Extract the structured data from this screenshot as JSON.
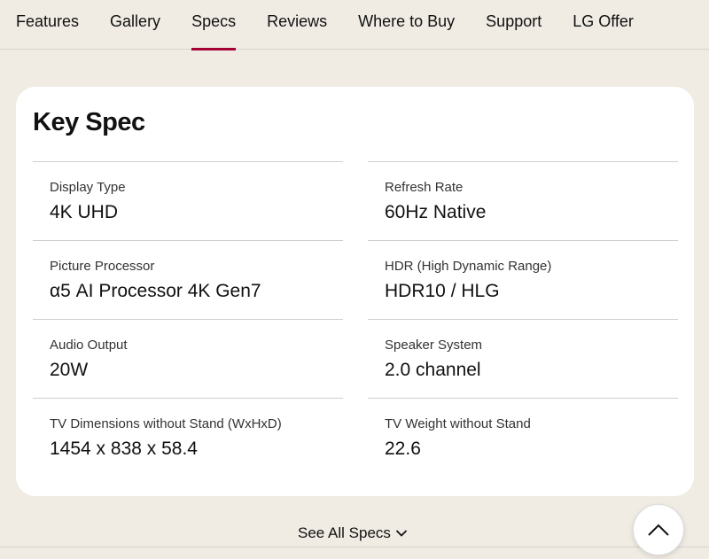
{
  "nav": {
    "tabs": [
      {
        "label": "Features"
      },
      {
        "label": "Gallery"
      },
      {
        "label": "Specs",
        "active": true
      },
      {
        "label": "Reviews"
      },
      {
        "label": "Where to Buy"
      },
      {
        "label": "Support"
      },
      {
        "label": "LG Offer"
      }
    ],
    "active_color": "#a50034"
  },
  "key_spec": {
    "title": "Key Spec",
    "specs": [
      {
        "label": "Display Type",
        "value": "4K UHD"
      },
      {
        "label": "Refresh Rate",
        "value": "60Hz Native"
      },
      {
        "label": "Picture Processor",
        "value": "α5 AI Processor 4K Gen7"
      },
      {
        "label": "HDR (High Dynamic Range)",
        "value": "HDR10 / HLG"
      },
      {
        "label": "Audio Output",
        "value": "20W"
      },
      {
        "label": "Speaker System",
        "value": "2.0 channel"
      },
      {
        "label": "TV Dimensions without Stand (WxHxD)",
        "value": "1454 x 838 x 58.4"
      },
      {
        "label": "TV Weight without Stand",
        "value": "22.6"
      }
    ]
  },
  "see_all": {
    "label": "See All Specs",
    "icon": "chevron-down-icon"
  },
  "scroll_top": {
    "icon": "chevron-up-icon"
  },
  "colors": {
    "background": "#f0ece4",
    "card": "#ffffff",
    "accent": "#a50034"
  }
}
